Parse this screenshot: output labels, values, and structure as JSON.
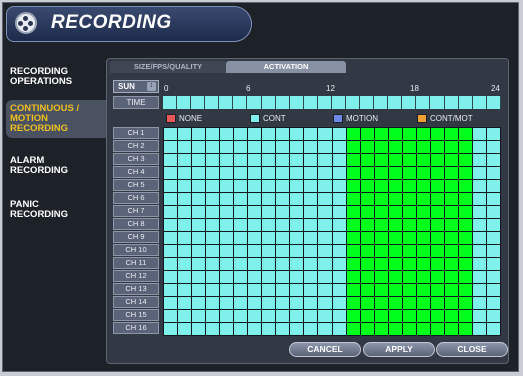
{
  "header": {
    "title": "RECORDING",
    "icon": "film-reel-icon"
  },
  "sidebar": {
    "items": [
      {
        "label_lines": [
          "RECORDING",
          "OPERATIONS"
        ],
        "active": false
      },
      {
        "label_lines": [
          "CONTINUOUS /",
          "MOTION",
          "RECORDING"
        ],
        "active": true
      },
      {
        "label_lines": [
          "ALARM",
          "RECORDING"
        ],
        "active": false
      },
      {
        "label_lines": [
          "PANIC",
          "RECORDING"
        ],
        "active": false
      }
    ]
  },
  "tabs": [
    {
      "label": "SIZE/FPS/QUALITY",
      "active": false
    },
    {
      "label": "ACTIVATION",
      "active": true
    }
  ],
  "schedule": {
    "day": "SUN",
    "time_label": "TIME",
    "hour_marks": [
      "0",
      "6",
      "12",
      "18",
      "24"
    ],
    "channels": [
      "CH 1",
      "CH 2",
      "CH 3",
      "CH 4",
      "CH 5",
      "CH 6",
      "CH 7",
      "CH 8",
      "CH 9",
      "CH 10",
      "CH 11",
      "CH 12",
      "CH 13",
      "CH 14",
      "CH 15",
      "CH 16"
    ],
    "motion_hours": [
      13,
      14,
      15,
      16,
      17,
      18,
      19,
      20,
      21
    ]
  },
  "legend": [
    {
      "label": "NONE",
      "color": "#e8585a"
    },
    {
      "label": "CONT",
      "color": "#7ff0ec"
    },
    {
      "label": "MOTION",
      "color": "#6f88e8"
    },
    {
      "label": "CONT/MOT",
      "color": "#f0a030"
    }
  ],
  "colors": {
    "cont": "#7ff0ec",
    "motion_block": "#00ff1a"
  },
  "buttons": {
    "cancel": "CANCEL",
    "apply": "APPLY",
    "close": "CLOSE"
  }
}
